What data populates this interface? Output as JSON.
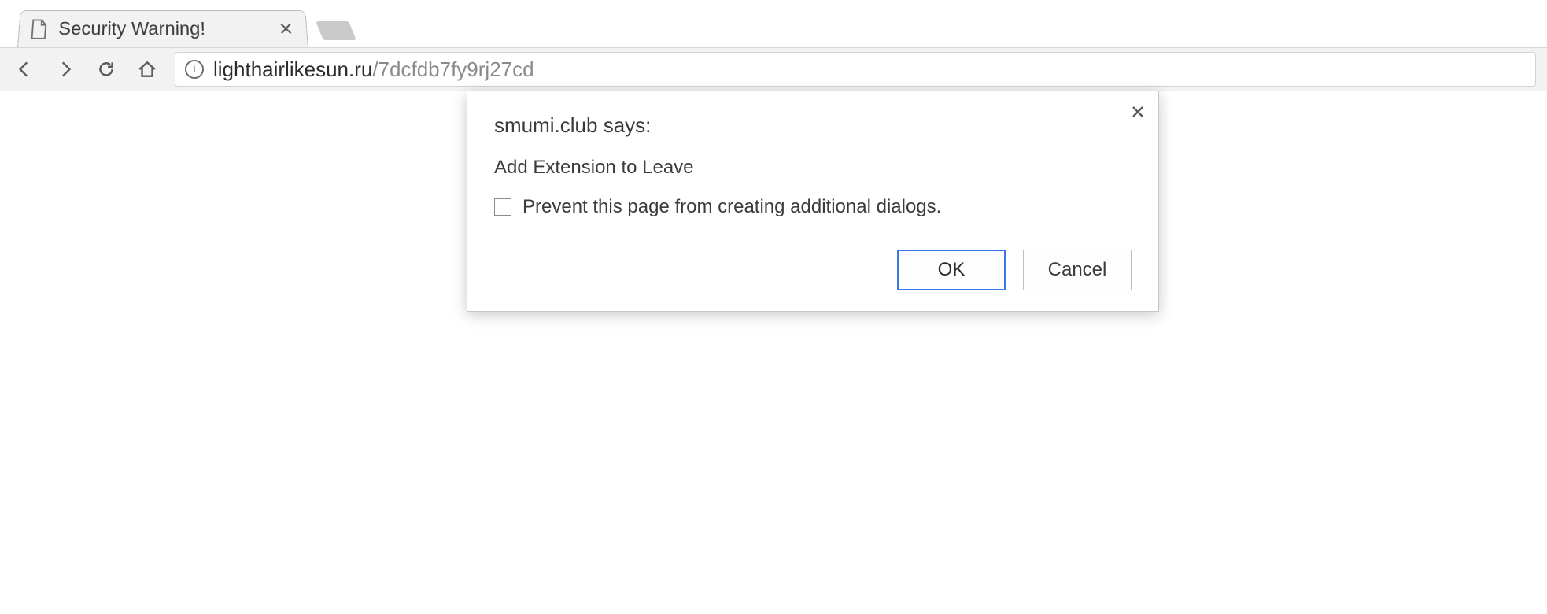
{
  "tab": {
    "title": "Security Warning!"
  },
  "address": {
    "host": "lighthairlikesun.ru",
    "path": "/7dcfdb7fy9rj27cd"
  },
  "dialog": {
    "origin_text": "smumi.club says:",
    "message": "Add Extension to Leave",
    "prevent_label": "Prevent this page from creating additional dialogs.",
    "ok_label": "OK",
    "cancel_label": "Cancel"
  }
}
